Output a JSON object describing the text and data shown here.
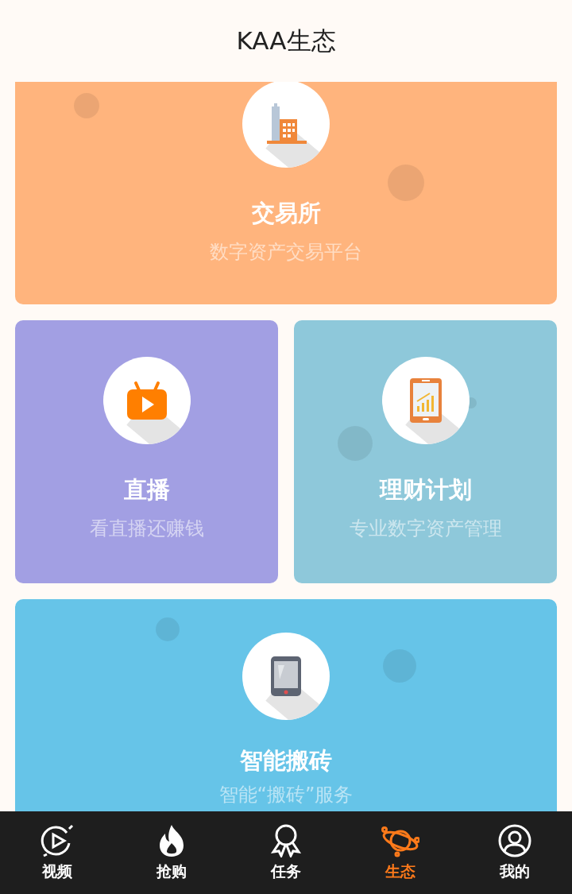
{
  "header": {
    "title": "KAA生态"
  },
  "cards": [
    {
      "kind": "wide",
      "title": "交易所",
      "subtitle": "数字资产交易平台",
      "color": "#ffb47d"
    },
    {
      "kind": "half",
      "title": "直播",
      "subtitle": "看直播还赚钱",
      "color": "#a29fe3"
    },
    {
      "kind": "half",
      "title": "理财计划",
      "subtitle": "专业数字资产管理",
      "color": "#8ec8da"
    },
    {
      "kind": "wide",
      "title": "智能搬砖",
      "subtitle": "智能“搬砖”服务",
      "color": "#66c4e8"
    }
  ],
  "nav": [
    {
      "label": "视频",
      "selected": false
    },
    {
      "label": "抢购",
      "selected": false
    },
    {
      "label": "任务",
      "selected": false
    },
    {
      "label": "生态",
      "selected": true
    },
    {
      "label": "我的",
      "selected": false
    }
  ]
}
